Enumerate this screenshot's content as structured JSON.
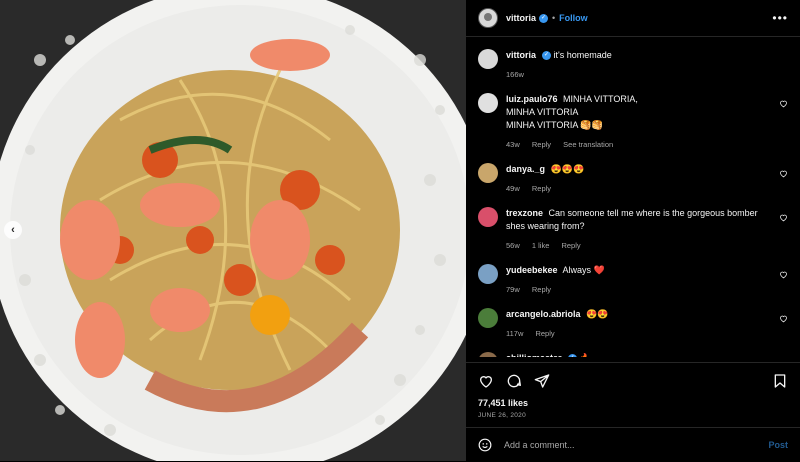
{
  "post": {
    "username": "vittoria",
    "follow_label": "Follow",
    "more_glyph": "•••",
    "caption": "it's homemade",
    "caption_time": "166w"
  },
  "comments": [
    {
      "user": "luiz.paulo76",
      "text": "MINHA VITTORIA,",
      "text2": "MINHA VITTORIA",
      "text3": "MINHA VITTORIA 🥞🥞",
      "time": "43w",
      "reply": "Reply",
      "translate": "See translation",
      "avatar_color": "#e0e0e0"
    },
    {
      "user": "danya._g",
      "text": "😍😍😍",
      "time": "49w",
      "reply": "Reply",
      "avatar_color": "#c9a66b"
    },
    {
      "user": "trexzone",
      "text": "Can someone tell me where is the gorgeous bomber shes wearing from?",
      "time": "56w",
      "likes": "1 like",
      "reply": "Reply",
      "avatar_color": "#d94f6a"
    },
    {
      "user": "yudeebekee",
      "text": "Always ❤️",
      "time": "79w",
      "reply": "Reply",
      "avatar_color": "#7aa0c4"
    },
    {
      "user": "arcangelo.abriola",
      "text": "😍😍",
      "time": "117w",
      "reply": "Reply",
      "avatar_color": "#4b7d3a"
    },
    {
      "user": "chilliomaster",
      "text": "🔥",
      "avatar_color": "#8a6a4a"
    }
  ],
  "stats": {
    "likes": "77,451 likes",
    "date": "JUNE 26, 2020"
  },
  "comment_box": {
    "placeholder": "Add a comment...",
    "post_label": "Post"
  },
  "icons": {
    "like": "heart-icon",
    "comment": "comment-icon",
    "share": "share-icon",
    "save": "bookmark-icon",
    "emoji": "smiley-icon",
    "prev": "chevron-left-icon"
  },
  "colors": {
    "accent": "#3897f0",
    "muted": "#a8a8a8",
    "background": "#000000"
  }
}
